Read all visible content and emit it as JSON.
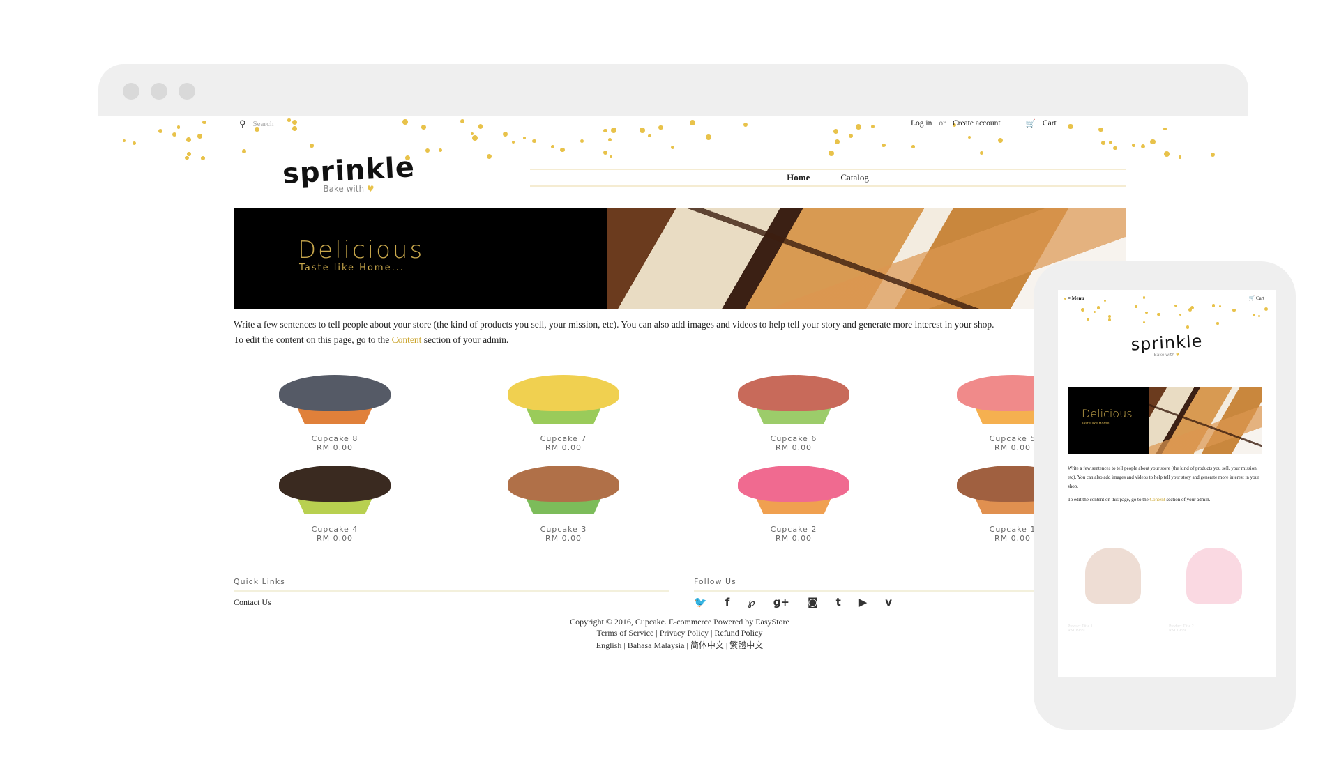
{
  "header": {
    "search_placeholder": "Search",
    "login": "Log in",
    "or": "or",
    "create_account": "Create account",
    "cart": "Cart"
  },
  "logo": {
    "name": "sprinkle",
    "tagline": "Bake with",
    "heart": "♥"
  },
  "nav": [
    {
      "label": "Home",
      "active": true
    },
    {
      "label": "Catalog",
      "active": false
    }
  ],
  "banner": {
    "title": "Delicious",
    "subtitle": "Taste like Home..."
  },
  "intro": {
    "line1": "Write a few sentences to tell people about your store (the kind of products you sell, your mission, etc). You can also add images and videos to help tell your story and generate more interest in your shop.",
    "line2_pre": "To edit the content on this page, go to the ",
    "line2_link": "Content",
    "line2_post": " section of your admin."
  },
  "products": [
    {
      "name": "Cupcake 8",
      "price": "RM 0.00",
      "frost": "#555a66",
      "liner": "#e0803a"
    },
    {
      "name": "Cupcake 7",
      "price": "RM 0.00",
      "frost": "#f0d050",
      "liner": "#9acb5a"
    },
    {
      "name": "Cupcake 6",
      "price": "RM 0.00",
      "frost": "#c86a5a",
      "liner": "#9ccc6a"
    },
    {
      "name": "Cupcake 5",
      "price": "RM 0.00",
      "frost": "#f08a8a",
      "liner": "#f5b050"
    },
    {
      "name": "Cupcake 4",
      "price": "RM 0.00",
      "frost": "#3a2a20",
      "liner": "#b8d050"
    },
    {
      "name": "Cupcake 3",
      "price": "RM 0.00",
      "frost": "#b07048",
      "liner": "#7cbc5a"
    },
    {
      "name": "Cupcake 2",
      "price": "RM 0.00",
      "frost": "#f06a90",
      "liner": "#f0a050"
    },
    {
      "name": "Cupcake 1",
      "price": "RM 0.00",
      "frost": "#a06040",
      "liner": "#e09050"
    }
  ],
  "footer": {
    "quick_links_title": "Quick Links",
    "contact": "Contact Us",
    "follow_title": "Follow Us",
    "social": [
      {
        "icon": "twitter-icon",
        "glyph": "🐦"
      },
      {
        "icon": "facebook-icon",
        "glyph": "f"
      },
      {
        "icon": "pinterest-icon",
        "glyph": "℘"
      },
      {
        "icon": "google-plus-icon",
        "glyph": "g+"
      },
      {
        "icon": "instagram-icon",
        "glyph": "◙"
      },
      {
        "icon": "tumblr-icon",
        "glyph": "t"
      },
      {
        "icon": "youtube-icon",
        "glyph": "▶"
      },
      {
        "icon": "vimeo-icon",
        "glyph": "v"
      }
    ],
    "copyright": "Copyright © 2016, Cupcake. E-commerce Powered by EasyStore",
    "policies": "Terms of Service | Privacy Policy | Refund Policy",
    "languages": "English | Bahasa Malaysia | 简体中文 | 繁體中文"
  },
  "mobile": {
    "menu": "Menu",
    "cart": "Cart",
    "products": [
      {
        "name": "Product Title 1",
        "price": "RM 19.99"
      },
      {
        "name": "Product Title 2",
        "price": "RM 19.99"
      }
    ]
  },
  "colors": {
    "accent": "#c9a227",
    "sprinkle": "#e8c24a",
    "frame": "#efefef"
  }
}
